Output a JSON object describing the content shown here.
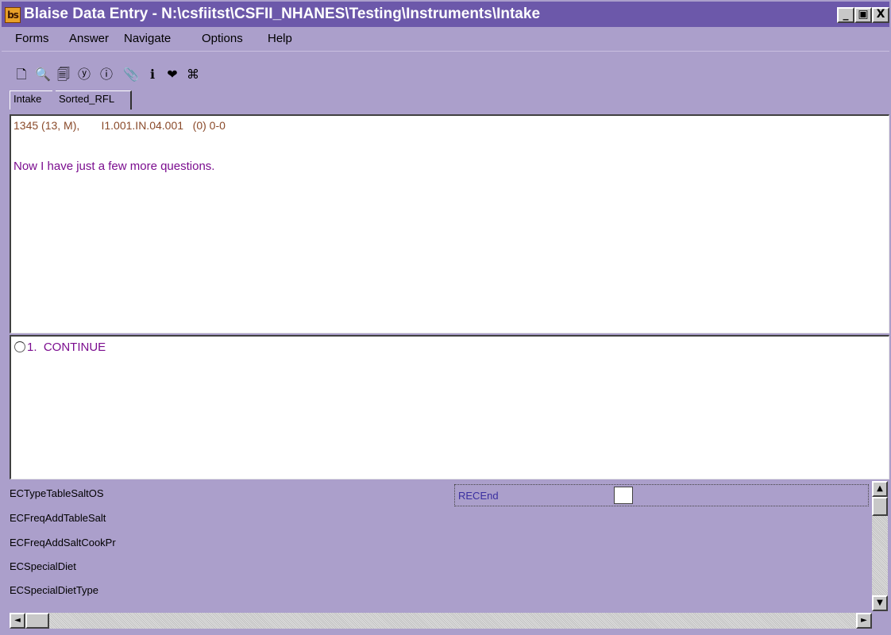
{
  "window": {
    "title": "Blaise Data Entry - N:\\csfiitst\\CSFII_NHANES\\Testing\\Instruments\\Intake",
    "app_icon_text": "bs",
    "buttons": {
      "minimize": "_",
      "restore": "▣",
      "close": "X"
    }
  },
  "menu": {
    "items": [
      "Forms",
      "Answer",
      "Navigate",
      "Options",
      "Help"
    ]
  },
  "toolbar": {
    "icons": [
      "new-form-icon",
      "find-form-icon",
      "browse-forms-icon",
      "help-icon",
      "error-icon",
      "attach-icon",
      "info-icon",
      "edit-icon",
      "network-icon"
    ],
    "glyphs": [
      "🗋",
      "🔍",
      "🗐",
      "ⓨ",
      "ⓘ",
      "📎",
      "ℹ",
      "❤",
      "⌘"
    ]
  },
  "tabs": [
    "Intake",
    "Sorted_RFL"
  ],
  "question": {
    "header": "1345 (13, M),       I1.001.IN.04.001   (0) 0-0",
    "text": "Now I have just a few more questions."
  },
  "answer": {
    "options": [
      "1.  CONTINUE"
    ]
  },
  "field_list": {
    "rows": [
      "ECTypeTableSaltOS",
      "ECFreqAddTableSalt",
      "ECFreqAddSaltCookPr",
      "ECSpecialDiet",
      "ECSpecialDietType"
    ],
    "current_field": "RECEnd",
    "current_value": ""
  },
  "scrollbars": {
    "up": "▲",
    "down": "▼",
    "left": "◄",
    "right": "►"
  },
  "colors": {
    "title_bar": "#6c58aa",
    "window_bg": "#ab9fcb",
    "question_text": "#7b0d8f",
    "header_text": "#8a4a2a"
  }
}
